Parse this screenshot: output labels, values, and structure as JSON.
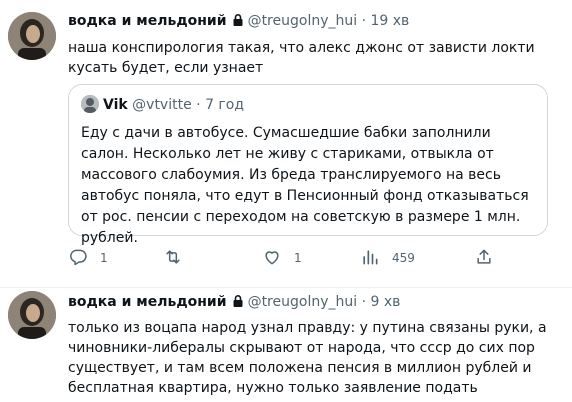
{
  "tweets": [
    {
      "display_name": "водка и мельдоний",
      "handle": "@treugolny_hui",
      "separator": "·",
      "time": "19 хв",
      "text": "наша конспирология такая, что алекс джонс от зависти локти кусать будет, если узнает",
      "quote": {
        "display_name": "Vik",
        "handle": "@vtvitte",
        "separator": "·",
        "time": "7 год",
        "text": "Еду с дачи в автобусе. Сумасшедшие бабки заполнили салон. Несколько лет не живу с стариками, отвыкла от массового слабоумия. Из бреда транслируемого на весь автобус поняла, что едут в Пенсионный фонд отказываться от рос. пенсии с переходом на советскую в размере 1 млн. рублей."
      },
      "actions": {
        "reply_count": "1",
        "retweet_count": "",
        "like_count": "1",
        "views_count": "459"
      }
    },
    {
      "display_name": "водка и мельдоний",
      "handle": "@treugolny_hui",
      "separator": "·",
      "time": "9 хв",
      "text": "только из воцапа народ узнал правду: у путина связаны руки, а чиновники-либералы скрывают от народа, что ссср до сих пор существует, и там всем положена пенсия в миллион рублей и бесплатная квартира, нужно только заявление подать"
    }
  ],
  "icons": {
    "reply": "reply-icon",
    "retweet": "retweet-icon",
    "like": "heart-icon",
    "views": "views-icon",
    "share": "share-icon",
    "lock": "lock-icon"
  },
  "colors": {
    "text": "#0f1419",
    "muted": "#536471",
    "border": "#cfd9de"
  }
}
